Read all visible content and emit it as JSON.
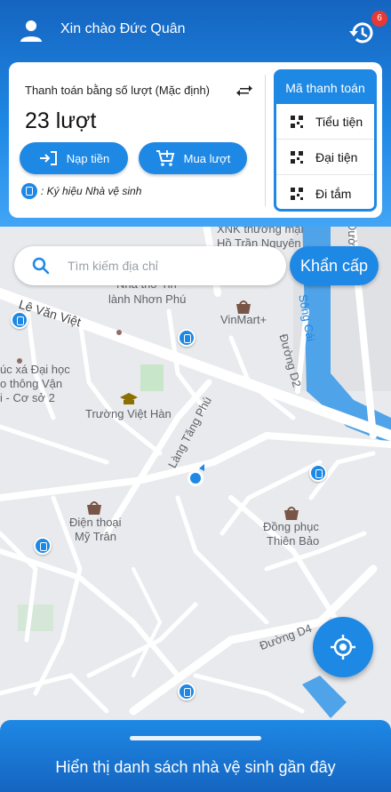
{
  "header": {
    "greeting": "Xin chào Đức Quân",
    "history_badge": "6"
  },
  "payment": {
    "mode_label": "Thanh toán bằng số lượt (Mặc định)",
    "count": "23 lượt",
    "topup_label": "Nạp tiền",
    "buy_label": "Mua lượt",
    "legend_text": ": Ký hiệu Nhà vệ sinh"
  },
  "payment_codes": {
    "title": "Mã thanh toán",
    "items": [
      "Tiểu tiện",
      "Đại tiện",
      "Đi tắm"
    ]
  },
  "search": {
    "placeholder": "Tìm kiếm địa chỉ",
    "value": ""
  },
  "emergency_label": "Khẩn cấp",
  "map_labels": {
    "street_le_van_viet": "Lê Văn Việt",
    "street_lang_tang_phu": "Làng Tăng Phú",
    "street_d2": "Đường D2",
    "street_d4": "Đường D4",
    "street_d1": "Đường D1",
    "song_cai": "Sông Cái",
    "xnk_1": "XNK thương mại",
    "xnk_2": "Hồ Trần Nguyên",
    "nha_tho_1": "Nhà thờ Tin",
    "nha_tho_2": "lành Nhơn Phú",
    "vinmart": "VinMart+",
    "dai_hoc_1": "úc xá Đại học",
    "dai_hoc_2": "o thông Vận",
    "dai_hoc_3": "i - Cơ sở 2",
    "truong_viet_han": "Trường Việt Hàn",
    "dien_thoai_1": "Điện thoại",
    "dien_thoai_2": "Mỹ Trân",
    "dong_phuc_1": "Đồng phục",
    "dong_phuc_2": "Thiên Bảo"
  },
  "bottom_sheet": {
    "label": "Hiển thị danh sách nhà vệ sinh gần đây"
  },
  "colors": {
    "primary": "#1e88e5",
    "primary_dark": "#1565c0",
    "badge": "#e53935",
    "water": "#4fa3e8"
  },
  "icons": [
    "user-icon",
    "history-icon",
    "swap-icon",
    "wallet-icon",
    "cart-icon",
    "qr-icon",
    "search-icon",
    "locate-icon",
    "toilet-pin-icon"
  ]
}
